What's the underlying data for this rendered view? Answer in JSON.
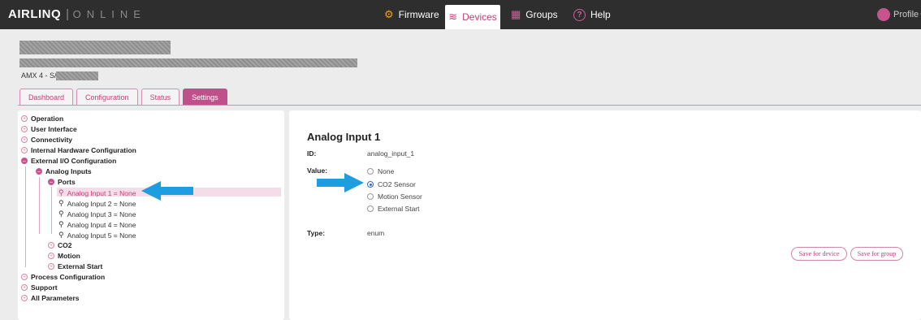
{
  "app": {
    "brand_main": "AIRLINQ",
    "brand_sub": "ONLINE"
  },
  "nav": {
    "firmware": "Firmware",
    "devices": "Devices",
    "groups": "Groups",
    "help": "Help",
    "profile": "Profile"
  },
  "device": {
    "serial_prefix": "AMX 4 - S/N"
  },
  "tabs": [
    "Dashboard",
    "Configuration",
    "Status",
    "Settings"
  ],
  "tree": {
    "operation": "Operation",
    "user_interface": "User Interface",
    "connectivity": "Connectivity",
    "internal_hw": "Internal Hardware Configuration",
    "external_io": "External I/O Configuration",
    "analog_inputs": "Analog Inputs",
    "ports": "Ports",
    "port_items": [
      "Analog Input 1 = None",
      "Analog Input 2 = None",
      "Analog Input 3 = None",
      "Analog Input 4 = None",
      "Analog Input 5 = None"
    ],
    "co2": "CO2",
    "motion": "Motion",
    "external_start": "External Start",
    "process_config": "Process Configuration",
    "support": "Support",
    "all_params": "All Parameters"
  },
  "detail": {
    "title": "Analog Input 1",
    "id_label": "ID:",
    "id_value": "analog_input_1",
    "value_label": "Value:",
    "options": [
      "None",
      "CO2 Sensor",
      "Motion Sensor",
      "External Start"
    ],
    "selected_option": "CO2 Sensor",
    "type_label": "Type:",
    "type_value": "enum",
    "save_device": "Save for device",
    "save_group": "Save for group"
  },
  "colors": {
    "accent": "#c0508a",
    "arrow": "#1e9ee0",
    "topbar": "#2e2e2e"
  }
}
